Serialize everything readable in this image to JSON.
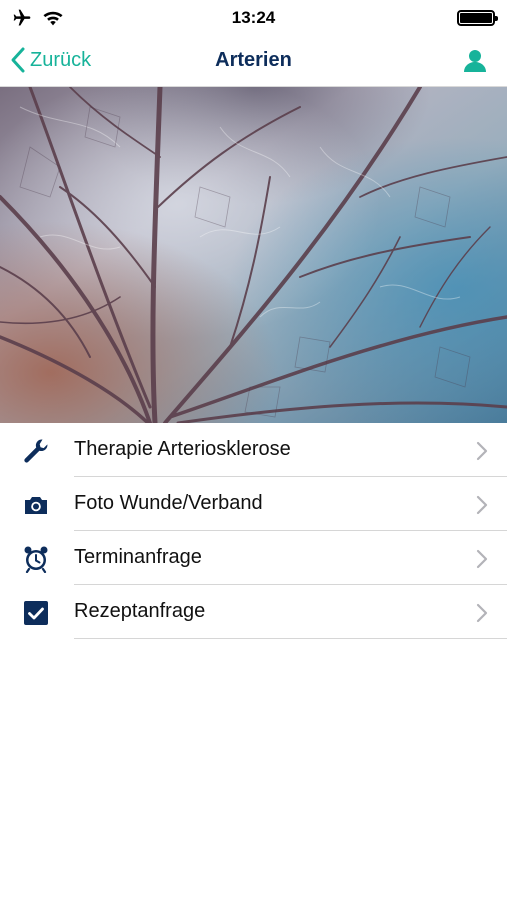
{
  "status_bar": {
    "time": "13:24",
    "battery_level": 1.0,
    "icons": [
      "airplane-icon",
      "wifi-icon",
      "battery-icon"
    ]
  },
  "nav": {
    "back_label": "Zurück",
    "title": "Arterien",
    "accent_color": "#17b39a",
    "title_color": "#0d2d5b"
  },
  "menu": {
    "icon_color": "#0d2d5b",
    "items": [
      {
        "label": "Therapie Arteriosklerose",
        "icon": "wrench-icon"
      },
      {
        "label": "Foto Wunde/Verband",
        "icon": "camera-icon"
      },
      {
        "label": "Terminanfrage",
        "icon": "alarm-clock-icon"
      },
      {
        "label": "Rezeptanfrage",
        "icon": "checkbox-icon"
      }
    ]
  }
}
